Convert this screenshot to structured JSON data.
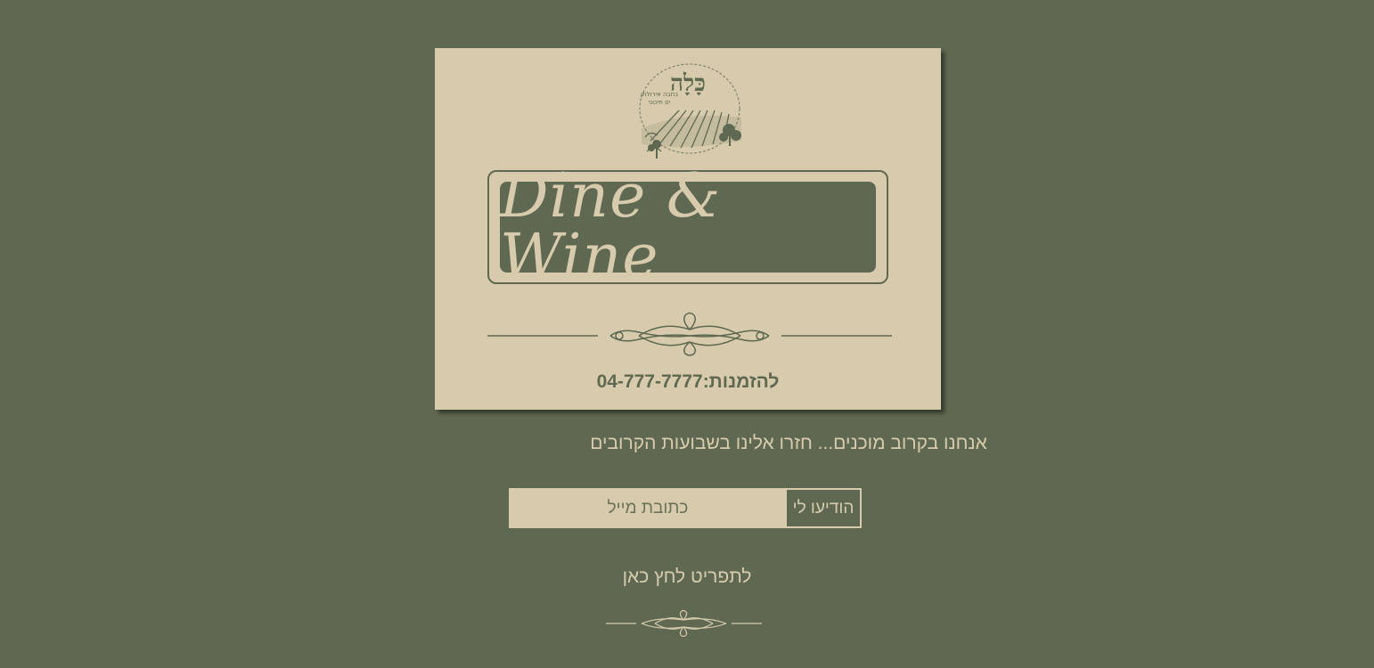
{
  "logo": {
    "hebrew_name": "כָּלָה",
    "hebrew_subtitle_1": "בחבה אירולוק",
    "hebrew_subtitle_2": "ים תיכוני",
    "icon": "vineyard-logo-icon"
  },
  "title": "Dine & Wine",
  "phone_text": "להזמנות:04-777-7777",
  "coming_soon": "אנחנו בקרוב מוכנים... חזרו אלינו בשבועות הקרובים",
  "form": {
    "email_placeholder": "כתובת מייל",
    "email_value": "",
    "submit_label": "הודיעו לי"
  },
  "menu_link": "לתפריט לחץ כאן",
  "colors": {
    "background": "#5f6951",
    "card": "#d8cbad",
    "accent": "#5f6951"
  }
}
